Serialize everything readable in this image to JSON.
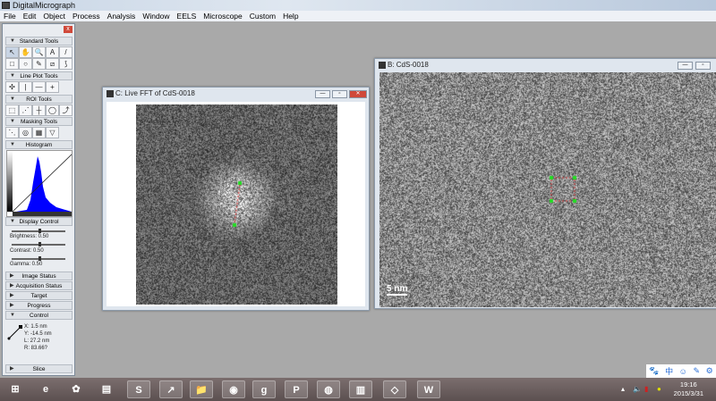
{
  "app": {
    "title": "DigitalMicrograph"
  },
  "menu": [
    "File",
    "Edit",
    "Object",
    "Process",
    "Analysis",
    "Window",
    "EELS",
    "Microscope",
    "Custom",
    "Help"
  ],
  "panel": {
    "close": "x",
    "sections": {
      "standard": "Standard Tools",
      "lineplot": "Line Plot Tools",
      "roi": "ROI Tools",
      "masking": "Masking Tools",
      "histogram": "Histogram",
      "display": "Display Control",
      "image_status": "Image Status",
      "acquisition": "Acquisition Status",
      "target": "Target",
      "progress": "Progress",
      "control": "Control",
      "slice": "Slice"
    },
    "standard_tools": [
      "↖",
      "✋",
      "🔍",
      "A",
      "/",
      "□",
      "○",
      "✎",
      "⧄",
      "⟆"
    ],
    "lineplot_tools": [
      "✣",
      "|",
      "—",
      "+"
    ],
    "roi_tools": [
      "⬚",
      "⋰",
      "┼",
      "◯",
      "⤴"
    ],
    "masking_tools": [
      "⋱",
      "◎",
      "▦",
      "▽"
    ],
    "display": {
      "brightness": "Brightness: 0.50",
      "contrast": "Contrast: 0.50",
      "gamma": "Gamma: 0.50",
      "brightness_value": 0.5,
      "contrast_value": 0.5,
      "gamma_value": 0.5
    },
    "control": {
      "x": "X: 1.5 nm",
      "y": "Y: -14.5 nm",
      "l": "L: 27.2 nm",
      "r": "R: 83.66?"
    }
  },
  "windows": {
    "fft": {
      "title": "C: Live FFT of CdS-0018"
    },
    "image": {
      "title": "B: CdS-0018",
      "scalebar": "5  nm"
    }
  },
  "ime": [
    "🐾",
    "中",
    "☺",
    "✎",
    "⚙"
  ],
  "taskbar": {
    "apps": [
      "start",
      "internet-explorer",
      "photos",
      "media",
      "sogou",
      "app-green",
      "file-explorer",
      "app-red",
      "app-blue",
      "powerpoint",
      "app-pink",
      "digitalmicrograph",
      "app-teal",
      "word"
    ],
    "labels": [
      "⊞",
      "e",
      "✿",
      "▤",
      "S",
      "↗",
      "📁",
      "◉",
      "g",
      "P",
      "◍",
      "▥",
      "◇",
      "W"
    ],
    "time": "19:16",
    "date": "2015/3/31"
  },
  "colors": {
    "accent": "#2a6fd8",
    "histogram": "#0000ff",
    "marker": "#22dd22"
  }
}
